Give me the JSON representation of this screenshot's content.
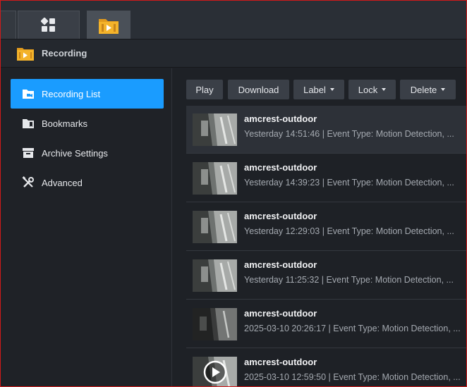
{
  "header": {
    "title": "Recording"
  },
  "sidebar": {
    "items": [
      {
        "label": "Recording List",
        "icon": "recording-folder-icon",
        "active": true
      },
      {
        "label": "Bookmarks",
        "icon": "bookmark-folder-icon",
        "active": false
      },
      {
        "label": "Archive Settings",
        "icon": "archive-box-icon",
        "active": false
      },
      {
        "label": "Advanced",
        "icon": "tools-icon",
        "active": false
      }
    ]
  },
  "toolbar": {
    "play": "Play",
    "download": "Download",
    "label": "Label",
    "lock": "Lock",
    "delete": "Delete"
  },
  "recordings": [
    {
      "camera": "amcrest-outdoor",
      "meta": "Yesterday 14:51:46 | Event Type: Motion Detection, ...",
      "selected": true
    },
    {
      "camera": "amcrest-outdoor",
      "meta": "Yesterday 14:39:23 | Event Type: Motion Detection, ..."
    },
    {
      "camera": "amcrest-outdoor",
      "meta": "Yesterday 12:29:03 | Event Type: Motion Detection, ..."
    },
    {
      "camera": "amcrest-outdoor",
      "meta": "Yesterday 11:25:32 | Event Type: Motion Detection, ..."
    },
    {
      "camera": "amcrest-outdoor",
      "meta": "2025-03-10 20:26:17 | Event Type: Motion Detection, ..."
    },
    {
      "camera": "amcrest-outdoor",
      "meta": "2025-03-10 12:59:50 | Event Type: Motion Detection, ..."
    }
  ],
  "colors": {
    "accent": "#1a9cff",
    "background": "#1e2126",
    "taskbar": "#2a2f36"
  }
}
